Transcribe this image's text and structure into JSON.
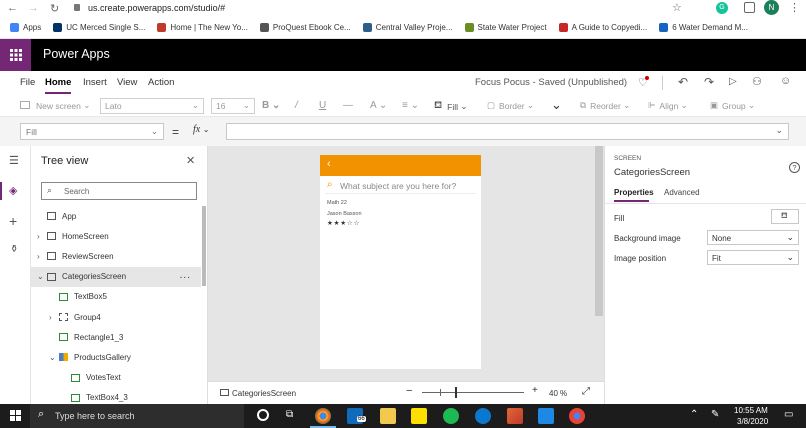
{
  "browser": {
    "url": "us.create.powerapps.com/studio/#",
    "bookmarks": [
      {
        "label": "Apps",
        "color": "#4285f4"
      },
      {
        "label": "UC Merced Single S...",
        "color": "#003366"
      },
      {
        "label": "Home | The New Yo...",
        "color": "#c0392b"
      },
      {
        "label": "ProQuest Ebook Ce...",
        "color": "#555555"
      },
      {
        "label": "Central Valley Proje...",
        "color": "#2e5e8a"
      },
      {
        "label": "State Water Project",
        "color": "#6a8e23"
      },
      {
        "label": "A Guide to Copyedi...",
        "color": "#c62828"
      },
      {
        "label": "6 Water Demand M...",
        "color": "#1565c0"
      }
    ],
    "profile_initial": "N",
    "extension_initial": "G"
  },
  "app": {
    "title": "Power Apps"
  },
  "menu": {
    "items": [
      "File",
      "Home",
      "Insert",
      "View",
      "Action"
    ],
    "active": "Home",
    "doc_status": "Focus Pocus - Saved (Unpublished)"
  },
  "toolbar": {
    "new_screen": "New screen",
    "font": "Lato",
    "font_size": "16",
    "fill": "Fill",
    "border": "Border",
    "reorder": "Reorder",
    "align": "Align",
    "group": "Group"
  },
  "formula": {
    "property": "Fill",
    "equals": "=",
    "fx": "fx",
    "value": ""
  },
  "tree": {
    "title": "Tree view",
    "search_placeholder": "Search",
    "items": [
      {
        "label": "App",
        "indent": 0,
        "kind": "app"
      },
      {
        "label": "HomeScreen",
        "indent": 0,
        "kind": "screen"
      },
      {
        "label": "ReviewScreen",
        "indent": 0,
        "kind": "screen"
      },
      {
        "label": "CategoriesScreen",
        "indent": 0,
        "kind": "screen",
        "selected": true,
        "more": "..."
      },
      {
        "label": "TextBox5",
        "indent": 1,
        "kind": "text"
      },
      {
        "label": "Group4",
        "indent": 1,
        "kind": "group"
      },
      {
        "label": "Rectangle1_3",
        "indent": 1,
        "kind": "rect"
      },
      {
        "label": "ProductsGallery",
        "indent": 1,
        "kind": "gallery"
      },
      {
        "label": "VotesText",
        "indent": 2,
        "kind": "text"
      },
      {
        "label": "TextBox4_3",
        "indent": 2,
        "kind": "text"
      }
    ]
  },
  "screen": {
    "header_color": "#f39200",
    "search_placeholder": "What subject are you here for?",
    "item_title": "Math 22",
    "item_author": "Jason Basson",
    "stars": "★ ★ ★ ☆ ☆"
  },
  "canvas_footer": {
    "screen_name": "CategoriesScreen",
    "zoom_minus": "−",
    "zoom_plus": "+",
    "zoom_value": "40",
    "zoom_unit": "%"
  },
  "props": {
    "caption": "SCREEN",
    "name": "CategoriesScreen",
    "help": "?",
    "tabs": [
      "Properties",
      "Advanced"
    ],
    "active_tab": "Properties",
    "rows": [
      {
        "label": "Fill",
        "value": ""
      },
      {
        "label": "Background image",
        "value": "None"
      },
      {
        "label": "Image position",
        "value": "Fit"
      }
    ]
  },
  "taskbar": {
    "search": "Type here to search",
    "time": "10:55 AM",
    "date": "3/8/2020",
    "mail_badge": "66"
  }
}
